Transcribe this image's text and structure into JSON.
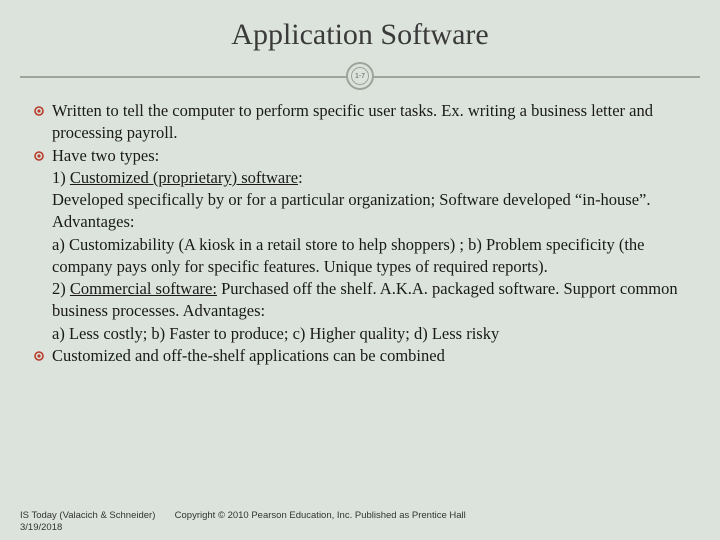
{
  "title": "Application Software",
  "pageNumber": "1-7",
  "bullets": [
    {
      "text": "Written to tell the computer to perform specific user tasks. Ex. writing a business letter and processing payroll."
    },
    {
      "lines": [
        "Have two types:",
        {
          "label": "1) ",
          "under": "Customized (proprietary) software",
          "after": ":"
        },
        "Developed specifically by or for a particular organization; Software developed “in-house”. Advantages:",
        "a) Customizability (A kiosk in a retail store to help shoppers) ; b) Problem specificity (the company pays only for specific features. Unique types of required reports).",
        {
          "label": "2) ",
          "under": "Commercial software:",
          "after": " Purchased off the shelf. A.K.A. packaged software. Support common business processes. Advantages:"
        },
        "a) Less costly; b) Faster to produce; c) Higher quality; d) Less risky"
      ]
    },
    {
      "text": "Customized and off-the-shelf applications can be combined"
    }
  ],
  "footer": {
    "source": "IS Today (Valacich & Schneider)",
    "copyright": "Copyright © 2010 Pearson Education, Inc. Published as Prentice Hall",
    "date": "3/19/2018"
  }
}
